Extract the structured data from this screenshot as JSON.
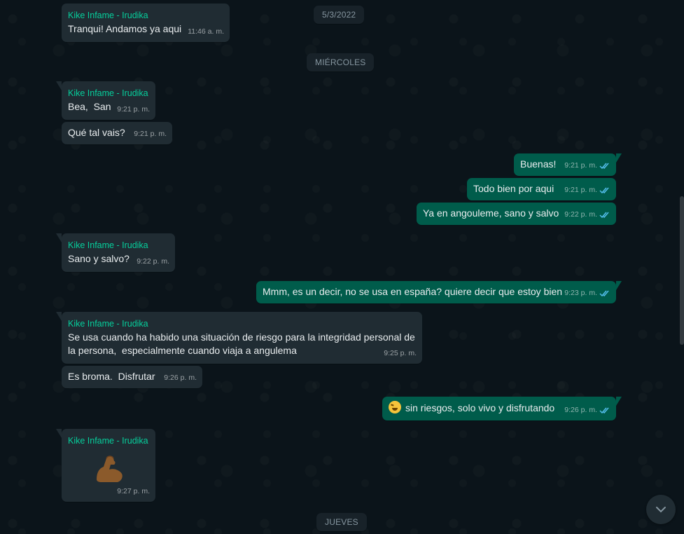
{
  "date_separators": {
    "top": "5/3/2022",
    "wednesday": "MIÉRCOLES",
    "thursday": "JUEVES"
  },
  "messages": [
    {
      "direction": "in",
      "sender": "Kike Infame - Irudika",
      "text": "Tranqui! Andamos ya aqui",
      "time": "11:46 a. m."
    },
    {
      "direction": "in",
      "sender": "Kike Infame - Irudika",
      "text": "Bea,  San",
      "time": "9:21 p. m."
    },
    {
      "direction": "in",
      "text": "Qué tal vais?",
      "time": "9:21 p. m."
    },
    {
      "direction": "out",
      "text": "Buenas!",
      "time": "9:21 p. m.",
      "status": "read"
    },
    {
      "direction": "out",
      "text": "Todo bien por aqui",
      "time": "9:21 p. m.",
      "status": "read"
    },
    {
      "direction": "out",
      "text": "Ya en angouleme, sano y salvo",
      "time": "9:22 p. m.",
      "status": "read"
    },
    {
      "direction": "in",
      "sender": "Kike Infame - Irudika",
      "text": "Sano y salvo?",
      "time": "9:22 p. m."
    },
    {
      "direction": "out",
      "text": "Mmm, es un decir, no se usa en españa? quiere decir que estoy bien",
      "time": "9:23 p. m.",
      "status": "read"
    },
    {
      "direction": "in",
      "sender": "Kike Infame - Irudika",
      "text": "Se usa cuando ha habido una situación de riesgo para la integridad personal de la persona,  especialmente cuando viaja a angulema",
      "time": "9:25 p. m."
    },
    {
      "direction": "in",
      "text": "Es broma.  Disfrutar",
      "time": "9:26 p. m."
    },
    {
      "direction": "out",
      "emoji": "grinning-squinting-face",
      "text": "sin riesgos, solo vivo y disfrutando",
      "time": "9:26 p. m.",
      "status": "read"
    },
    {
      "direction": "in",
      "sender": "Kike Infame - Irudika",
      "sticker": "flexed-biceps",
      "time": "9:27 p. m."
    }
  ],
  "colors": {
    "background": "#0b141a",
    "incoming_bubble": "#202c33",
    "outgoing_bubble": "#005c4b",
    "sender_name": "#06cf9c",
    "read_ticks": "#53bdeb",
    "date_pill": "#182229"
  },
  "scroll_down_icon": "chevron-down-icon"
}
